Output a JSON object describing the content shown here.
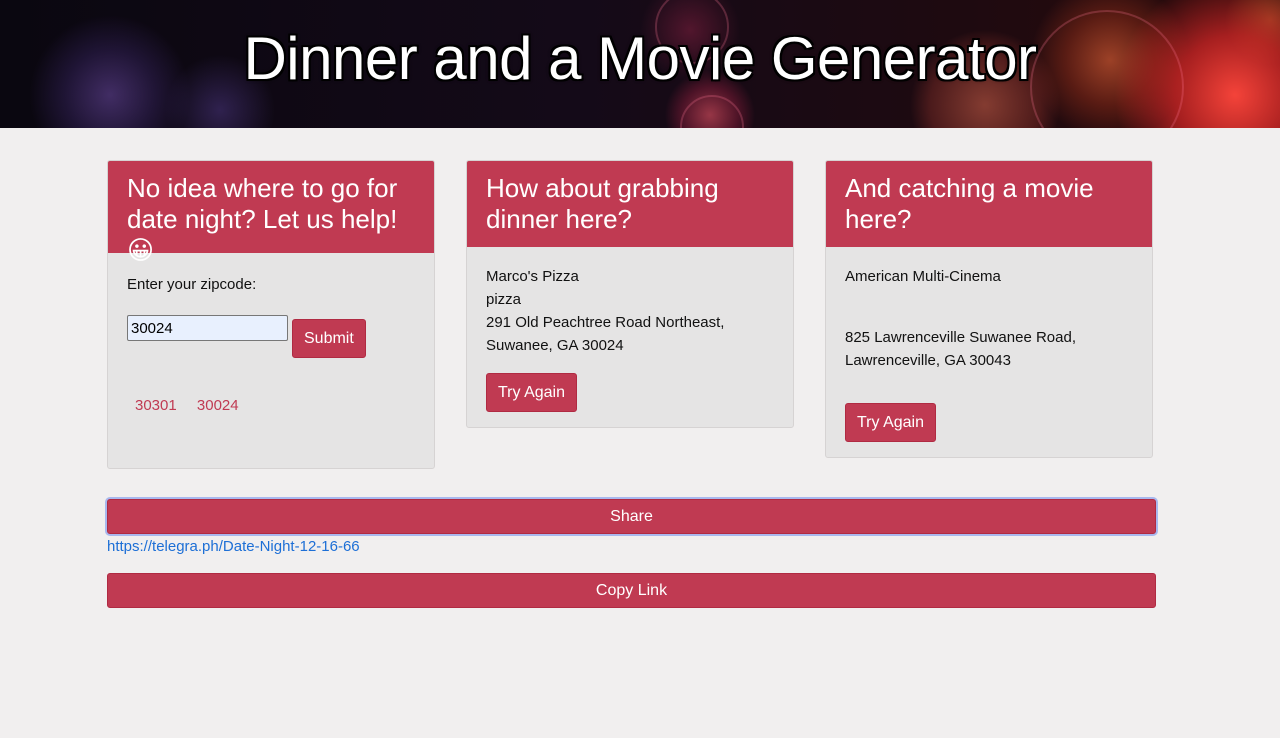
{
  "header": {
    "title": "Dinner and a Movie Generator"
  },
  "intro_card": {
    "heading": "No idea where to go for date night? Let us help! 😀",
    "zip_label": "Enter your zipcode:",
    "zip_value": "30024",
    "submit_label": "Submit",
    "recent_zips": [
      "30301",
      "30024"
    ]
  },
  "dinner_card": {
    "heading": "How about grabbing dinner here?",
    "name": "Marco's Pizza",
    "category": "pizza",
    "address_line1": "291 Old Peachtree Road Northeast,",
    "address_line2": "Suwanee, GA 30024",
    "retry_label": "Try Again"
  },
  "movie_card": {
    "heading": "And catching a movie here?",
    "name": "American Multi-Cinema",
    "address_line1": "825 Lawrenceville Suwanee Road,",
    "address_line2": "Lawrenceville, GA 30043",
    "retry_label": "Try Again"
  },
  "share": {
    "share_label": "Share",
    "link": "https://telegra.ph/Date-Night-12-16-66",
    "copy_label": "Copy Link"
  },
  "colors": {
    "accent": "#c03a52",
    "link": "#1d6fd6",
    "page_bg": "#f1efef",
    "card_bg": "#e5e4e4"
  }
}
